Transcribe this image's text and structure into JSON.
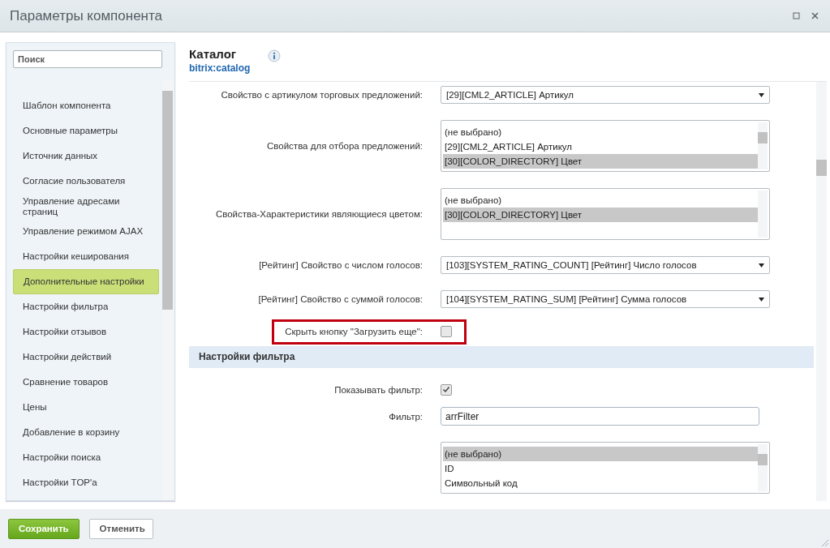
{
  "window": {
    "title": "Параметры компонента"
  },
  "sidebar": {
    "search": {
      "placeholder": "Поиск"
    },
    "items": [
      {
        "label": "Шаблон компонента",
        "selected": false
      },
      {
        "label": "Основные параметры",
        "selected": false
      },
      {
        "label": "Источник данных",
        "selected": false
      },
      {
        "label": "Согласие пользователя",
        "selected": false
      },
      {
        "label": "Управление адресами страниц",
        "selected": false
      },
      {
        "label": "Управление режимом AJAX",
        "selected": false
      },
      {
        "label": "Настройки кеширования",
        "selected": false
      },
      {
        "label": "Дополнительные настройки",
        "selected": true
      },
      {
        "label": "Настройки фильтра",
        "selected": false
      },
      {
        "label": "Настройки отзывов",
        "selected": false
      },
      {
        "label": "Настройки действий",
        "selected": false
      },
      {
        "label": "Сравнение товаров",
        "selected": false
      },
      {
        "label": "Цены",
        "selected": false
      },
      {
        "label": "Добавление в корзину",
        "selected": false
      },
      {
        "label": "Настройки поиска",
        "selected": false
      },
      {
        "label": "Настройки TOP'a",
        "selected": false
      }
    ]
  },
  "component": {
    "title": "Каталог",
    "code": "bitrix:catalog"
  },
  "fields": [
    {
      "kind": "select",
      "label": "Свойство с артикулом торговых предложений:",
      "value": "[29][CML2_ARTICLE] Артикул"
    },
    {
      "kind": "listbox",
      "label": "Свойства для отбора предложений:",
      "options": [
        {
          "text": "(не выбрано)",
          "selected": false
        },
        {
          "text": "[29][CML2_ARTICLE] Артикул",
          "selected": false
        },
        {
          "text": "[30][COLOR_DIRECTORY] Цвет",
          "selected": true
        }
      ]
    },
    {
      "kind": "listbox",
      "label": "Свойства-Характеристики являющиеся цветом:",
      "options": [
        {
          "text": "(не выбрано)",
          "selected": false
        },
        {
          "text": "[30][COLOR_DIRECTORY] Цвет",
          "selected": true
        }
      ]
    },
    {
      "kind": "select",
      "label": "[Рейтинг] Свойство с числом голосов:",
      "value": "[103][SYSTEM_RATING_COUNT] [Рейтинг] Число голосов"
    },
    {
      "kind": "select",
      "label": "[Рейтинг] Свойство с суммой голосов:",
      "value": "[104][SYSTEM_RATING_SUM] [Рейтинг] Сумма голосов"
    },
    {
      "kind": "checkbox",
      "label": "Скрыть кнопку \"Загрузить еще\":",
      "checked": false,
      "highlighted": true
    },
    {
      "kind": "section",
      "label": "Настройки фильтра"
    },
    {
      "kind": "checkbox",
      "label": "Показывать фильтр:",
      "checked": true,
      "highlighted": false
    },
    {
      "kind": "text",
      "label": "Фильтр:",
      "value": "arrFilter"
    },
    {
      "kind": "listbox",
      "options": [
        {
          "text": "(не выбрано)",
          "selected": true
        },
        {
          "text": "ID",
          "selected": false
        },
        {
          "text": "Символьный код",
          "selected": false
        }
      ]
    }
  ],
  "buttons": [
    {
      "label": "Сохранить",
      "kind": "primary"
    },
    {
      "label": "Отменить",
      "kind": "secondary"
    }
  ]
}
